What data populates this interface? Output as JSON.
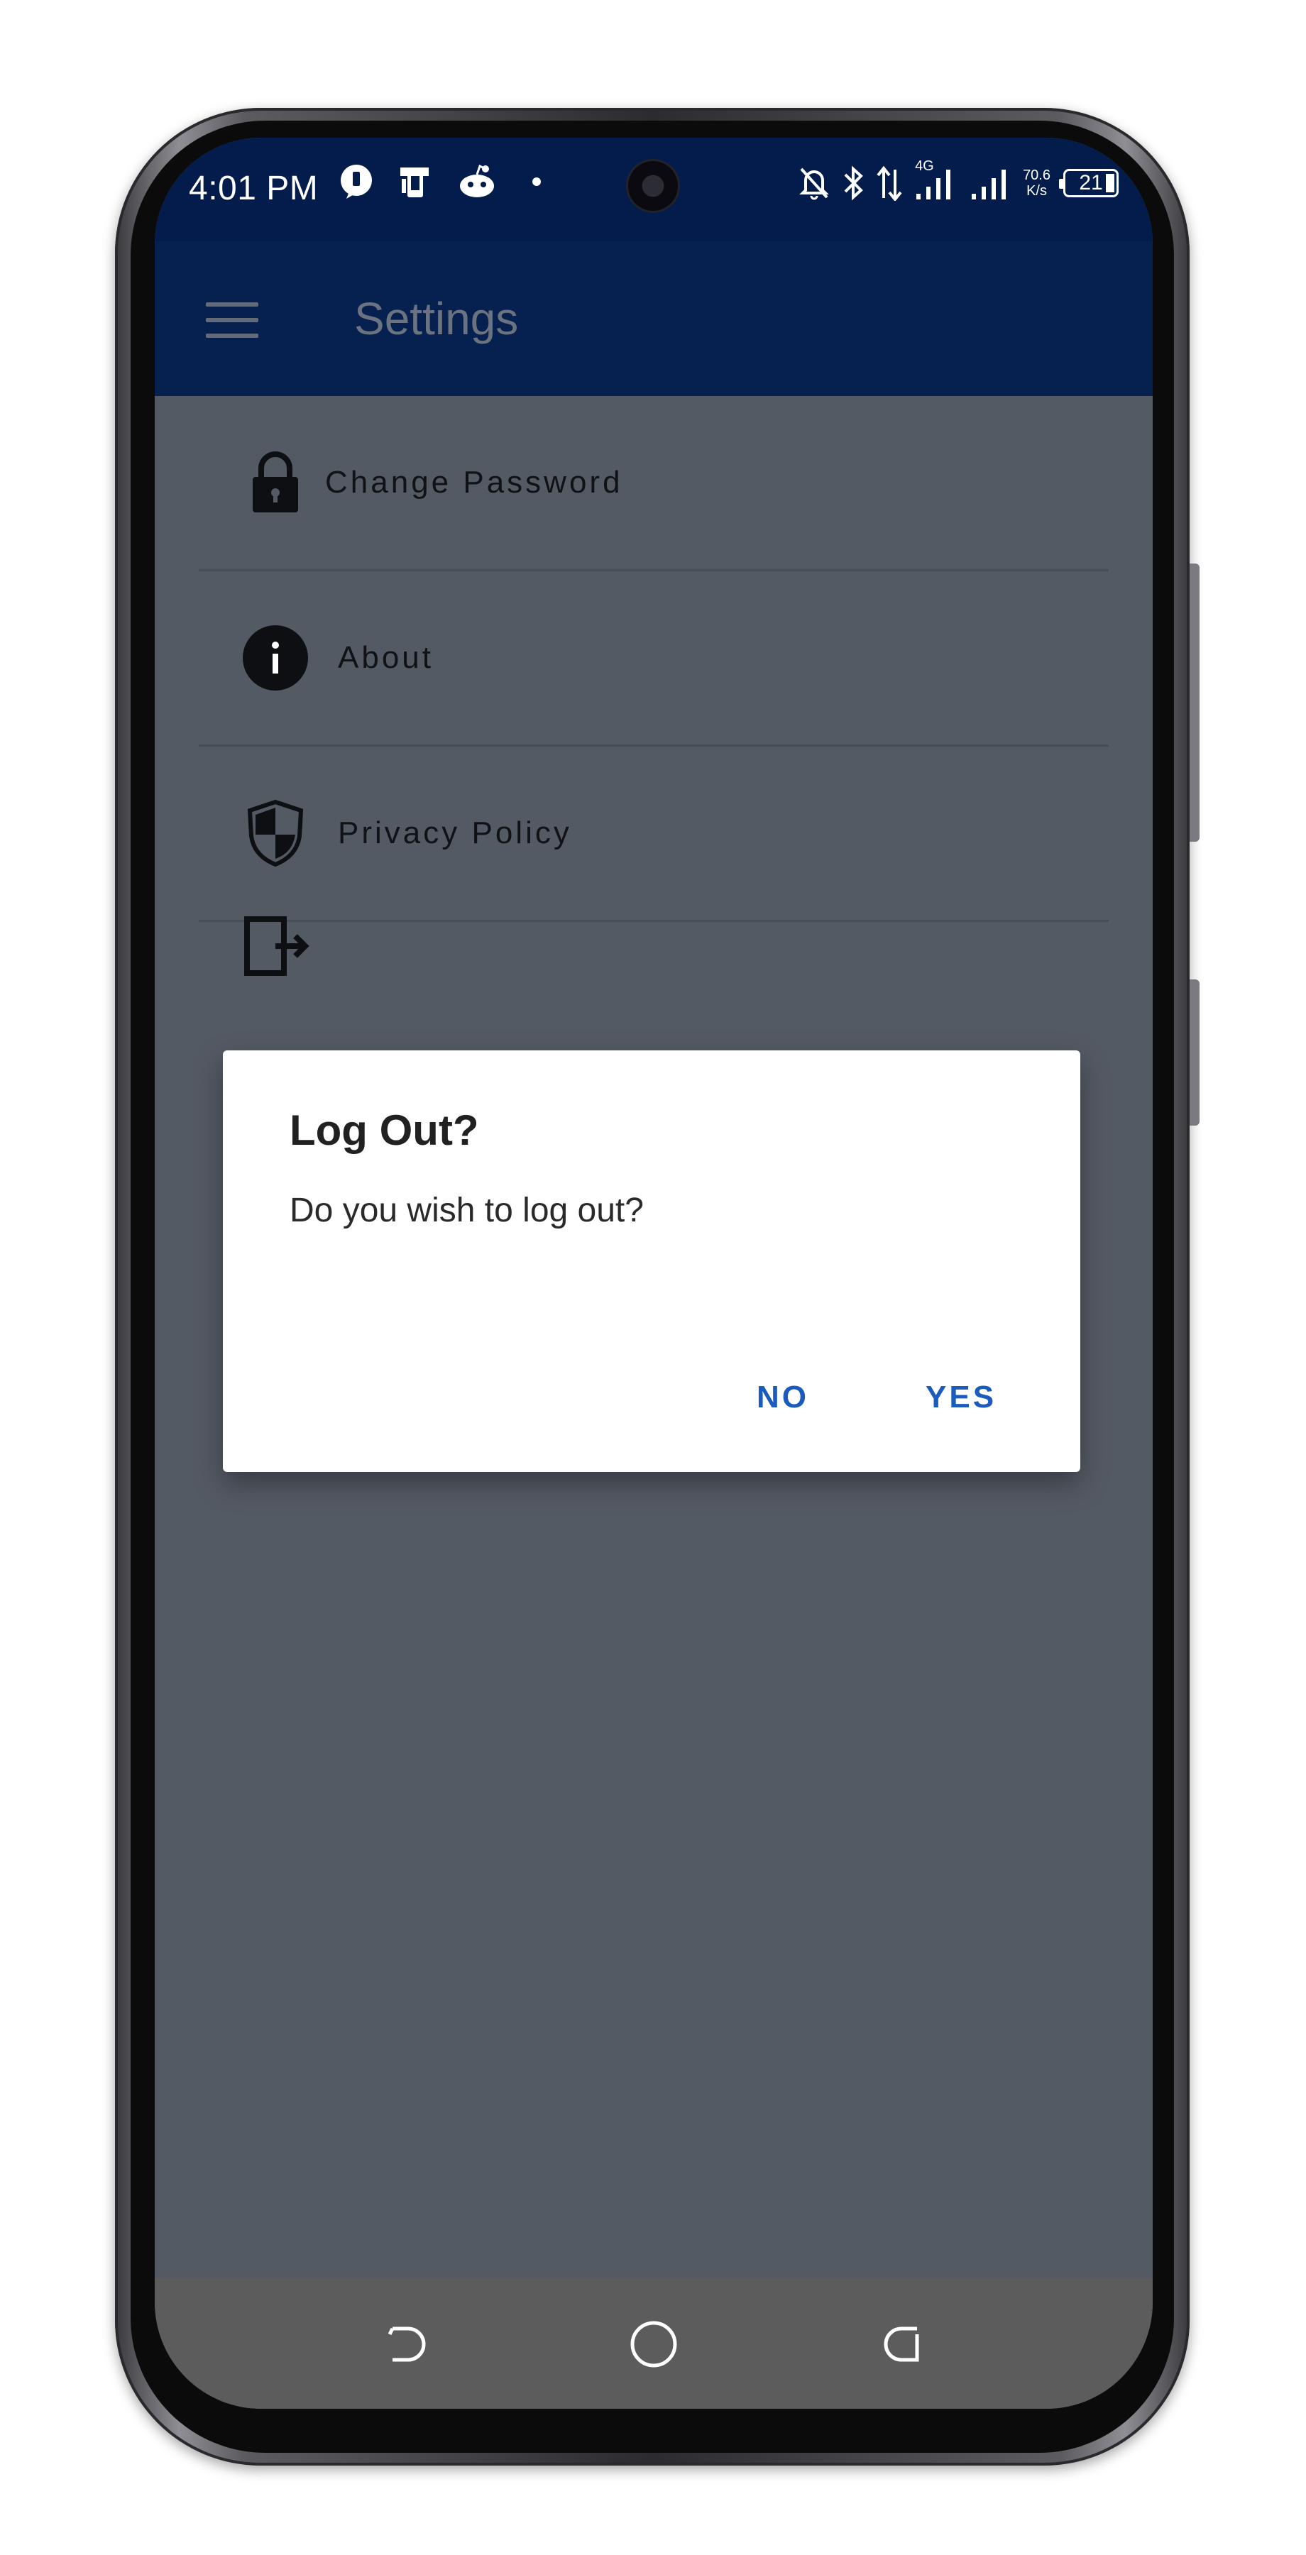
{
  "status_bar": {
    "time": "4:01 PM",
    "network_type": "4G",
    "net_speed_value": "70.6",
    "net_speed_unit": "K/s",
    "battery_level": "21",
    "icons": [
      "notification-app-icon",
      "phone-app-icon",
      "reddit-icon",
      "dot-icon",
      "mute-bell-icon",
      "bluetooth-icon",
      "data-arrows-icon",
      "signal-icon",
      "signal-icon-2"
    ]
  },
  "app_bar": {
    "title": "Settings",
    "menu_icon": "hamburger-menu-icon",
    "background": "#06214f"
  },
  "settings_list": {
    "items": [
      {
        "label": "Change Password",
        "icon": "lock-icon"
      },
      {
        "label": "About",
        "icon": "info-icon"
      },
      {
        "label": "Privacy Policy",
        "icon": "shield-icon"
      },
      {
        "label": "",
        "icon": "logout-icon"
      }
    ]
  },
  "dialog": {
    "title": "Log Out?",
    "message": "Do you wish to log out?",
    "negative_label": "NO",
    "positive_label": "YES",
    "accent": "#1a5bbd"
  },
  "nav_bar": {
    "buttons": [
      "back-icon",
      "home-icon",
      "recents-icon"
    ]
  }
}
